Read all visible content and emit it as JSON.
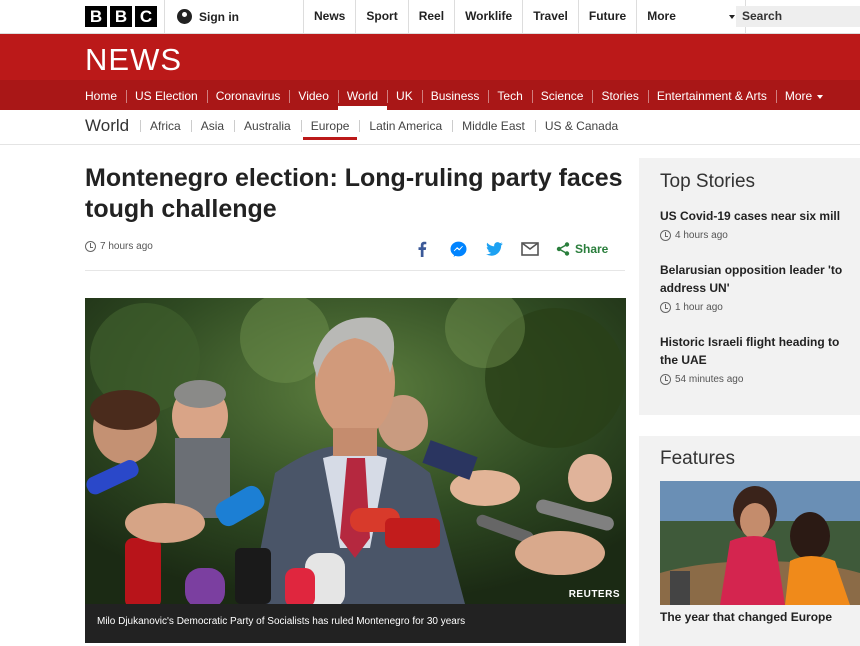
{
  "brand": {
    "letters": [
      "B",
      "B",
      "C"
    ],
    "section": "NEWS"
  },
  "topbar": {
    "signin": "Sign in",
    "nav": [
      "News",
      "Sport",
      "Reel",
      "Worklife",
      "Travel",
      "Future",
      "More"
    ],
    "search_placeholder": "Search"
  },
  "main_nav": {
    "items": [
      "Home",
      "US Election",
      "Coronavirus",
      "Video",
      "World",
      "UK",
      "Business",
      "Tech",
      "Science",
      "Stories",
      "Entertainment & Arts",
      "More"
    ],
    "active": "World"
  },
  "sub_nav": {
    "title": "World",
    "items": [
      "Africa",
      "Asia",
      "Australia",
      "Europe",
      "Latin America",
      "Middle East",
      "US & Canada"
    ],
    "active": "Europe"
  },
  "article": {
    "headline": "Montenegro election: Long-ruling party faces tough challenge",
    "timestamp": "7 hours ago",
    "share_label": "Share",
    "image_credit": "REUTERS",
    "caption": "Milo Djukanovic's Democratic Party of Socialists has ruled Montenegro for 30 years"
  },
  "top_stories": {
    "heading": "Top Stories",
    "items": [
      {
        "title_lines": [
          "US Covid-19 cases near six mill"
        ],
        "time": "4 hours ago"
      },
      {
        "title_lines": [
          "Belarusian opposition leader 'to",
          "address UN'"
        ],
        "time": "1 hour ago"
      },
      {
        "title_lines": [
          "Historic Israeli flight heading to",
          "the UAE"
        ],
        "time": "54 minutes ago"
      }
    ]
  },
  "features": {
    "heading": "Features",
    "item_title": "The year that changed Europe"
  },
  "colors": {
    "bbc_red": "#bb1919",
    "nav_red": "#a91717",
    "share_green": "#2a7e3c",
    "facebook_blue": "#3b5998",
    "messenger_blue": "#0084ff",
    "twitter_blue": "#1da1f2"
  },
  "icons": [
    "person-icon",
    "clock-icon",
    "facebook-icon",
    "messenger-icon",
    "twitter-icon",
    "email-icon",
    "share-icon",
    "caret-down-icon"
  ]
}
